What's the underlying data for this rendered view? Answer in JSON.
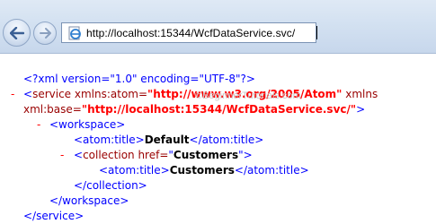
{
  "browser": {
    "address": "http://localhost:15344/WcfDataService.svc/",
    "back_icon": "back-arrow-icon",
    "forward_icon": "forward-arrow-icon",
    "page_icon": "ie-page-icon"
  },
  "xml": {
    "declaration": "<?xml version=\"1.0\" encoding=\"UTF-8\"?>",
    "collapse_marker": "-",
    "service_open_start": "<service xmlns:atom=",
    "service_xmlns_value": "\"http://www.w3.org/2005/Atom\"",
    "service_xmlns_attr": " xmlns",
    "service_base_attr": "xml:base=",
    "service_base_value": "\"http://localhost:15344/WcfDataService.svc/\"",
    "service_open_end": ">",
    "workspace_open": "<workspace>",
    "atom_title_open": "<atom:title>",
    "workspace_title": "Default",
    "atom_title_close": "</atom:title>",
    "collection_open_start": "<collection href=",
    "collection_href_q1": "\"",
    "collection_href": "Customers",
    "collection_href_q2": "\"",
    "collection_open_end": ">",
    "collection_title": "Customers",
    "collection_close": "</collection>",
    "workspace_close": "</workspace>",
    "service_close": "</service>"
  },
  "watermark": "©BeginnerTutorials.com"
}
